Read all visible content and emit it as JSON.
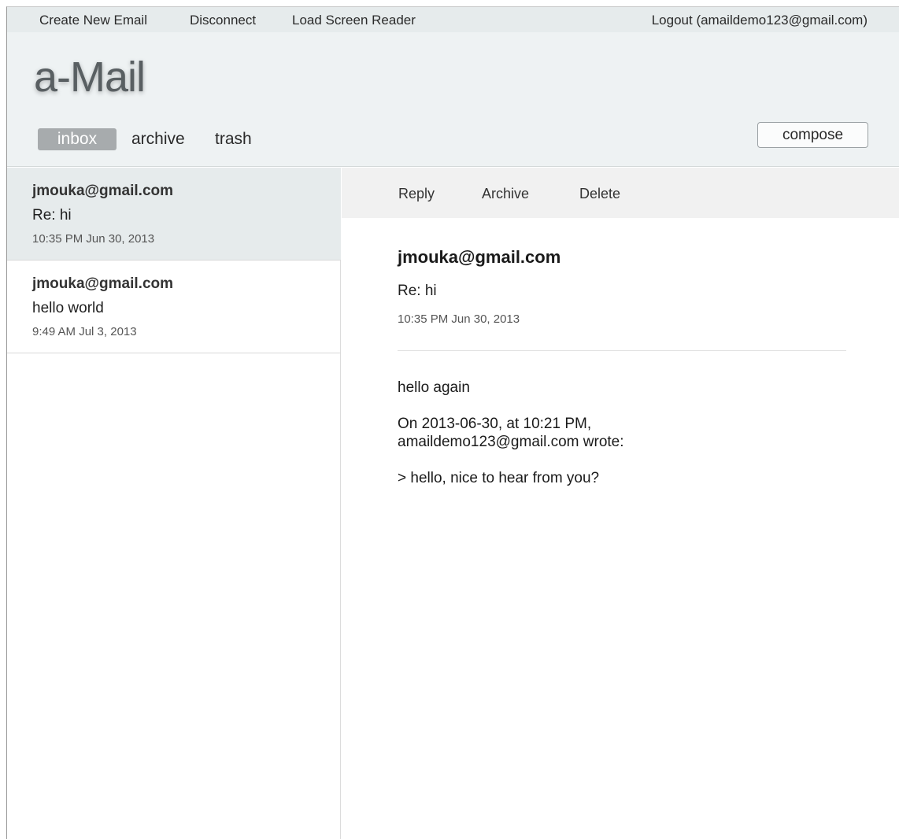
{
  "topbar": {
    "create_new_email": "Create New Email",
    "disconnect": "Disconnect",
    "load_screen_reader": "Load Screen Reader",
    "logout": "Logout (amaildemo123@gmail.com)"
  },
  "header": {
    "brand": "a-Mail",
    "folders": {
      "inbox": "inbox",
      "archive": "archive",
      "trash": "trash"
    },
    "compose_label": "compose"
  },
  "list": {
    "items": [
      {
        "from": "jmouka@gmail.com",
        "subject": "Re: hi",
        "date": "10:35 PM Jun 30, 2013"
      },
      {
        "from": "jmouka@gmail.com",
        "subject": "hello world",
        "date": "9:49 AM Jul 3, 2013"
      }
    ]
  },
  "actions": {
    "reply": "Reply",
    "archive": "Archive",
    "delete": "Delete"
  },
  "message": {
    "from": "jmouka@gmail.com",
    "subject": "Re: hi",
    "date": "10:35 PM Jun 30, 2013",
    "body": [
      "hello again",
      "On 2013-06-30, at 10:21 PM,\namaildemo123@gmail.com wrote:",
      "> hello, nice to hear from you?"
    ]
  },
  "colors": {
    "header_bg": "#eef2f3",
    "topbar_bg": "#e6ebec",
    "selected_item_bg": "#e6ebec",
    "active_folder_bg": "#a7abad"
  }
}
